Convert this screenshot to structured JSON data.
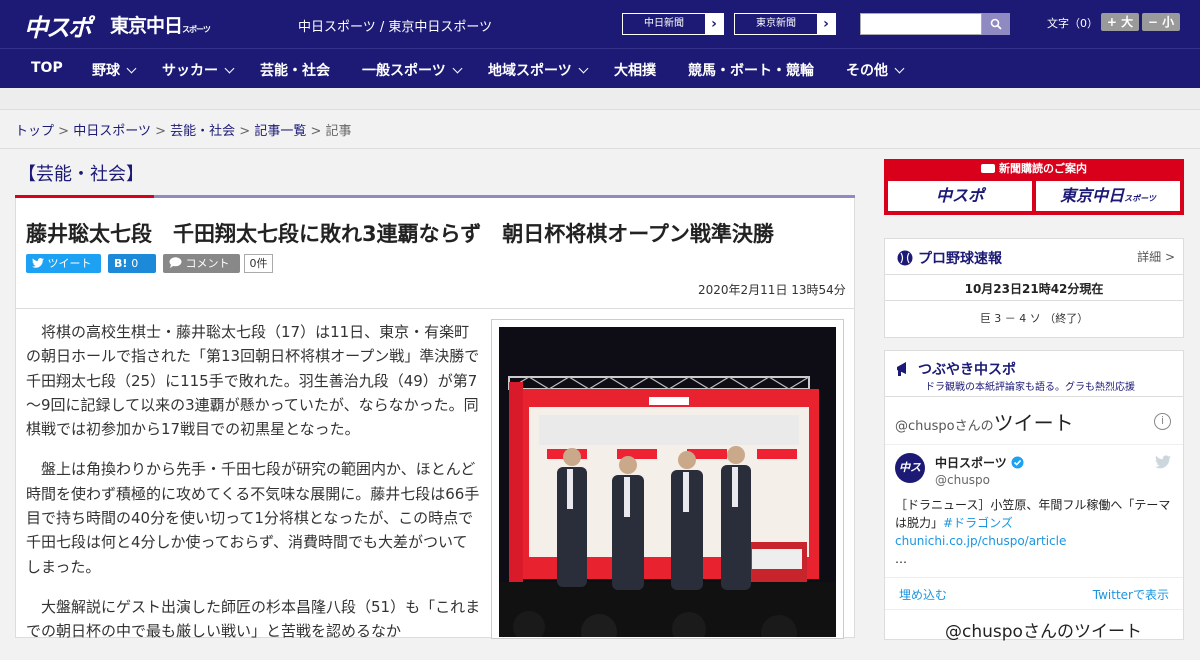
{
  "header": {
    "logo_chunichi": "中スポ",
    "logo_tokyo": "東京中日",
    "logo_tokyo_small": "スポーツ",
    "site_links": "中日スポーツ / 東京中日スポーツ",
    "btn_chunichi": "中日新聞",
    "btn_tokyo": "東京新聞",
    "search_placeholder": "",
    "font_size_label": "文字（0）",
    "font_bigger": "+ 大",
    "font_smaller": "− 小",
    "accent_color": "#1c1a75"
  },
  "nav": {
    "items": [
      {
        "label": "TOP"
      },
      {
        "label": "野球"
      },
      {
        "label": "サッカー"
      },
      {
        "label": "芸能・社会"
      },
      {
        "label": "一般スポーツ"
      },
      {
        "label": "地域スポーツ"
      },
      {
        "label": "大相撲"
      },
      {
        "label": "競馬・ボート・競輪"
      },
      {
        "label": "その他"
      }
    ]
  },
  "breadcrumb": {
    "items": [
      "トップ",
      "中日スポーツ",
      "芸能・社会",
      "記事一覧"
    ],
    "current": "記事",
    "separator": ">"
  },
  "category": {
    "title": "【芸能・社会】"
  },
  "article": {
    "title": "藤井聡太七段　千田翔太七段に敗れ3連覇ならず　朝日杯将棋オープン戦準決勝",
    "tweet_label": "ツイート",
    "hatena_label": "B!",
    "hatena_count": "0",
    "comment_label": "コメント",
    "comment_count": "0件",
    "date": "2020年2月11日 13時54分",
    "paragraphs": [
      "将棋の高校生棋士・藤井聡太七段（17）は11日、東京・有楽町の朝日ホールで指された「第13回朝日杯将棋オープン戦」準決勝で千田翔太七段（25）に115手で敗れた。羽生善治九段（49）が第7～9回に記録して以来の3連覇が懸かっていたが、ならなかった。同棋戦では初参加から17戦目での初黒星となった。",
      "盤上は角換わりから先手・千田七段が研究の範囲内か、ほとんど時間を使わず積極的に攻めてくる不気味な展開に。藤井七段は66手目で持ち時間の40分を使い切って1分将棋となったが、この時点で千田七段は何と4分しか使っておらず、消費時間でも大差がついてしまった。",
      "大盤解説にゲスト出演した師匠の杉本昌隆八段（51）も「これまでの朝日杯の中で最も厳しい戦い」と苦戦を認めるなか"
    ]
  },
  "sidebar": {
    "ad_header": "新聞購読のご案内",
    "ad_logo1": "中スポ",
    "ad_logo2": "東京中日",
    "ad_logo2_small": "スポーツ",
    "baseball": {
      "title": "プロ野球速報",
      "detail": "詳細 >",
      "time": "10月23日21時42分現在",
      "score": "巨  3 － 4  ソ  （終了）"
    },
    "twitter": {
      "title": "つぶやき中スポ",
      "subtitle": "ドラ観戦の本紙評論家も語る。グラも熱烈応援",
      "embed_prefix": "@chuspoさんの",
      "embed_title": "ツイート",
      "account_name": "中日スポーツ",
      "account_handle": "@chuspo",
      "tweet_text": "［ドラニュース］小笠原、年間フル稼働へ「テーマは脱力」",
      "tweet_link": "#ドラゴンズchunichi.co.jp/chuspo/article",
      "tweet_more": "…",
      "embed_label": "埋め込む",
      "view_on_twitter": "Twitterで表示",
      "next_title": "@chuspoさんのツイート"
    }
  }
}
